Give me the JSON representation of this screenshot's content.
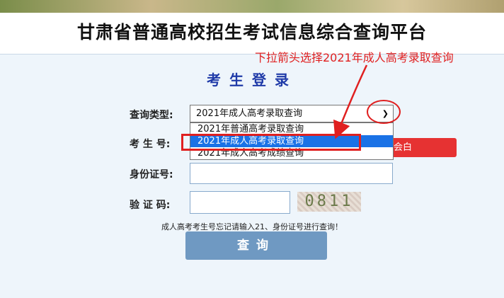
{
  "header": {
    "title": "甘肃省普通高校招生考试信息综合查询平台"
  },
  "annotation": {
    "text": "下拉箭头选择2021年成人高考录取查询",
    "color": "#e02020"
  },
  "login": {
    "title": "考生登录"
  },
  "form": {
    "query_type_label": "查询类型:",
    "exam_no_label": "考 生 号:",
    "id_label": "身份证号:",
    "captcha_label": "验 证 码:",
    "selected_value": "2021年成人高考录取查询",
    "options": [
      "2021年普通高考录取查询",
      "2021年成人高考录取查询",
      "2021年成人高考成绩查询"
    ],
    "highlighted_option_index": 1,
    "captcha_text": "0811",
    "partial_button_text": "会白",
    "hint": "成人高考考生号忘记请输入21、身份证号进行查询！",
    "query_button": "查询"
  },
  "colors": {
    "accent": "#1a72e6",
    "title_blue": "#1f3aa8",
    "button": "#6f99c2",
    "red": "#e63232"
  }
}
